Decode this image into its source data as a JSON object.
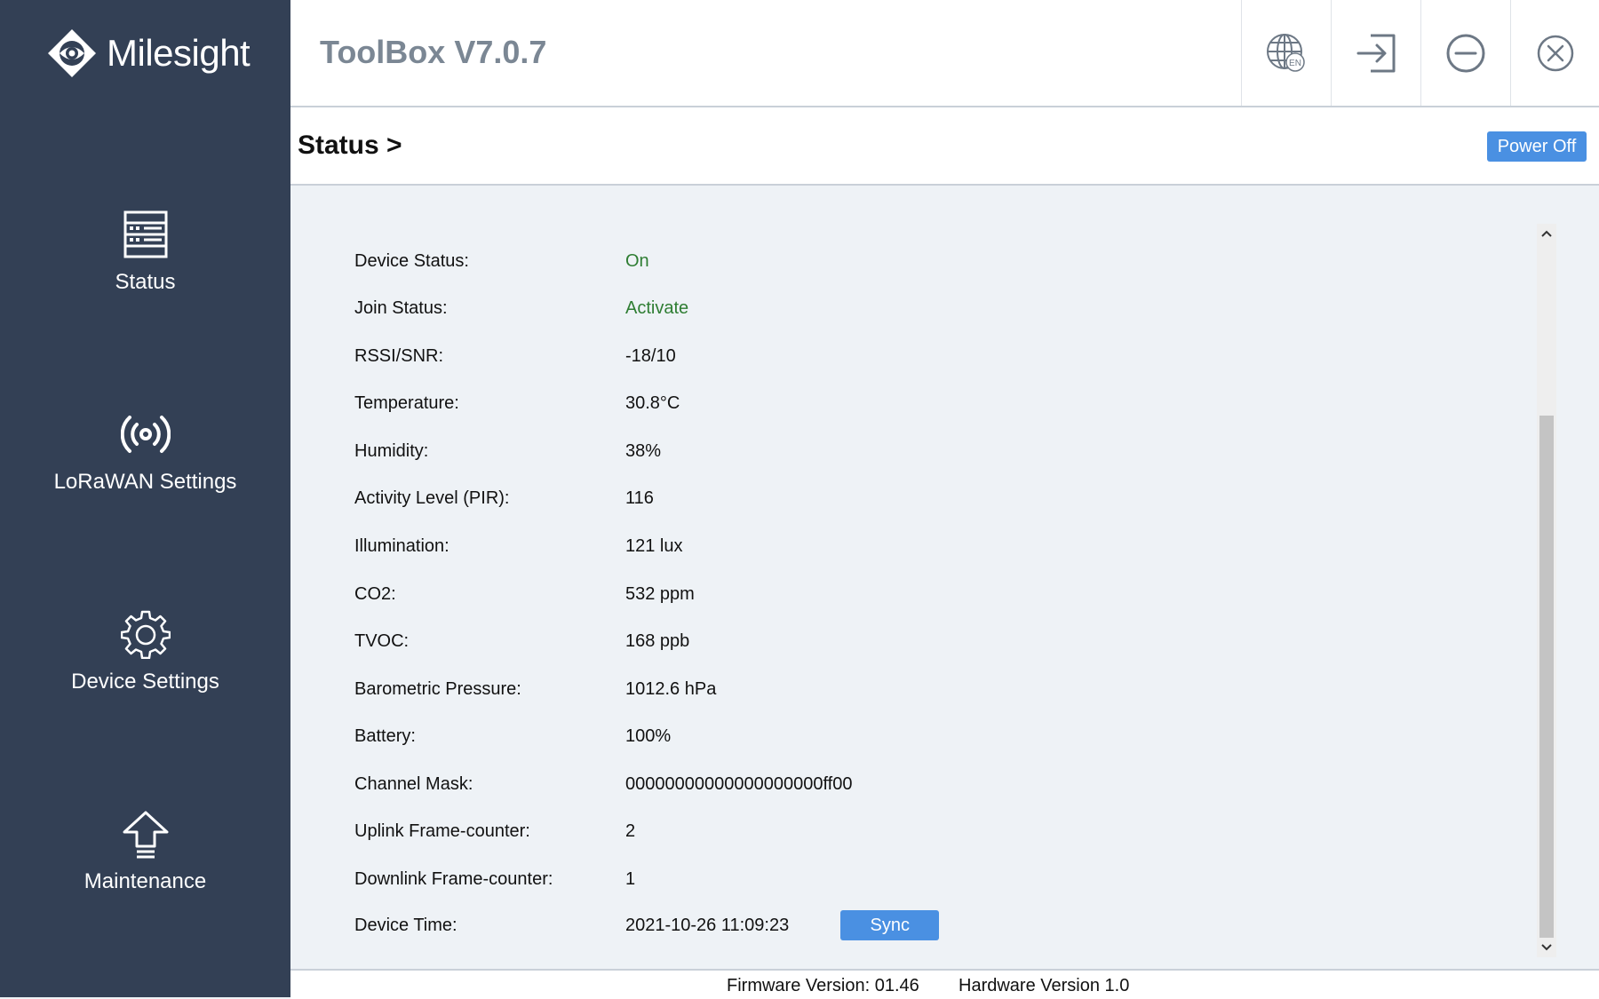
{
  "brand": {
    "name": "Milesight"
  },
  "app": {
    "title": "ToolBox V7.0.7"
  },
  "sidebar": {
    "items": [
      {
        "label": "Status",
        "icon": "server-icon"
      },
      {
        "label": "LoRaWAN Settings",
        "icon": "broadcast-icon"
      },
      {
        "label": "Device Settings",
        "icon": "gear-icon"
      },
      {
        "label": "Maintenance",
        "icon": "upload-arrow-icon"
      }
    ]
  },
  "topbar": {
    "language_badge": "EN",
    "icons": [
      "globe-language-icon",
      "login-icon",
      "minimize-icon",
      "close-icon"
    ]
  },
  "section": {
    "title": "Status >"
  },
  "power_off_label": "Power Off",
  "status": {
    "rows": [
      {
        "label": "Device Status:",
        "value": "On"
      },
      {
        "label": "Join Status:",
        "value": "Activate"
      },
      {
        "label": "RSSI/SNR:",
        "value": "-18/10"
      },
      {
        "label": "Temperature:",
        "value": "30.8°C"
      },
      {
        "label": "Humidity:",
        "value": "38%"
      },
      {
        "label": "Activity Level (PIR):",
        "value": "116"
      },
      {
        "label": "Illumination:",
        "value": "121 lux"
      },
      {
        "label": "CO2:",
        "value": "532 ppm"
      },
      {
        "label": "TVOC:",
        "value": "168 ppb"
      },
      {
        "label": "Barometric Pressure:",
        "value": "1012.6 hPa"
      },
      {
        "label": "Battery:",
        "value": "100%"
      },
      {
        "label": "Channel Mask:",
        "value": "00000000000000000000ff00"
      },
      {
        "label": "Uplink Frame-counter:",
        "value": "2"
      },
      {
        "label": "Downlink Frame-counter:",
        "value": "1"
      },
      {
        "label": "Device Time:",
        "value": "2021-10-26 11:09:23"
      }
    ],
    "sync_label": "Sync"
  },
  "colors": {
    "sidebar_bg": "#334055",
    "accent": "#4a90e2",
    "active_green": "#2e7d32"
  },
  "footer": {
    "firmware": "Firmware Version:  01.46",
    "hardware": "Hardware Version  1.0"
  }
}
